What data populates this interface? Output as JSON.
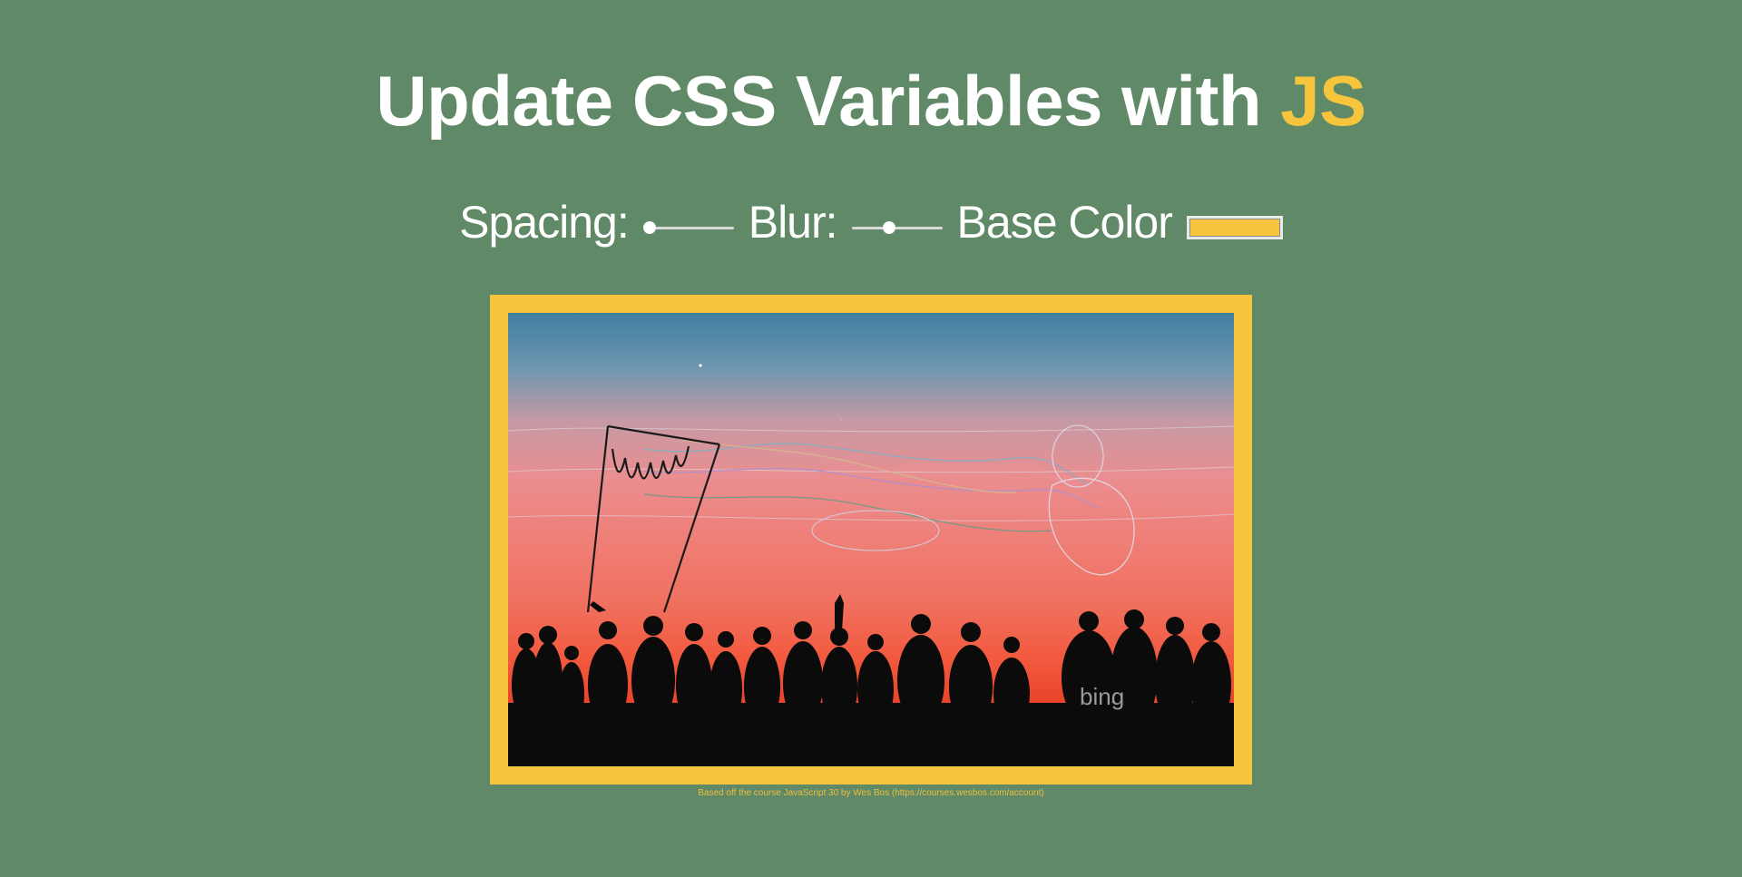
{
  "heading": {
    "text": "Update CSS Variables with ",
    "highlight": "JS"
  },
  "controls": {
    "spacing": {
      "label": "Spacing:",
      "value": 10,
      "min": 10,
      "max": 200
    },
    "blur": {
      "label": "Blur:",
      "value": 10,
      "min": 0,
      "max": 25
    },
    "base": {
      "label": "Base Color",
      "value": "#f7c43d"
    }
  },
  "photo": {
    "watermark": "bing"
  },
  "credit": "Based off the course JavaScript 30 by Wes Bos (https://courses.wesbos.com/account)",
  "colors": {
    "background": "#608a67",
    "accent": "#f7c43d",
    "text": "#ffffff"
  }
}
